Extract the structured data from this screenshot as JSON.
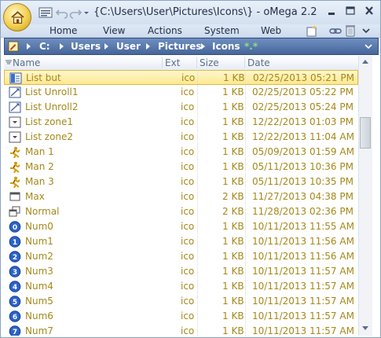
{
  "window": {
    "title": "{C:\\Users\\User\\Pictures\\Icons\\} - oMega 2.2"
  },
  "menu": [
    "Home",
    "View",
    "Actions",
    "System",
    "Web"
  ],
  "address": {
    "segments": [
      "C:",
      "Users",
      "User",
      "Pictures",
      "Icons",
      "*.*"
    ]
  },
  "columns": {
    "name": "Name",
    "ext": "Ext",
    "size": "Size",
    "date": "Date"
  },
  "files": [
    {
      "name": "List but",
      "ext": "ico",
      "size": "1 KB",
      "date": "02/25/2013 05:21 PM",
      "icon": "list-button-icon",
      "selected": true
    },
    {
      "name": "List Unroll1",
      "ext": "ico",
      "size": "1 KB",
      "date": "02/25/2013 05:22 PM",
      "icon": "list-unroll-icon"
    },
    {
      "name": "List Unroll2",
      "ext": "ico",
      "size": "1 KB",
      "date": "02/25/2013 05:24 PM",
      "icon": "list-unroll-icon"
    },
    {
      "name": "List zone1",
      "ext": "ico",
      "size": "1 KB",
      "date": "12/22/2013 01:03 PM",
      "icon": "list-zone-icon"
    },
    {
      "name": "List zone2",
      "ext": "ico",
      "size": "1 KB",
      "date": "12/22/2013 11:04 AM",
      "icon": "list-zone-icon"
    },
    {
      "name": "Man 1",
      "ext": "ico",
      "size": "1 KB",
      "date": "05/09/2013 01:59 AM",
      "icon": "running-man-icon"
    },
    {
      "name": "Man 2",
      "ext": "ico",
      "size": "1 KB",
      "date": "05/11/2013 10:36 PM",
      "icon": "running-man-icon"
    },
    {
      "name": "Man 3",
      "ext": "ico",
      "size": "1 KB",
      "date": "05/11/2013 10:35 PM",
      "icon": "running-man-icon"
    },
    {
      "name": "Max",
      "ext": "ico",
      "size": "2 KB",
      "date": "11/27/2013 04:38 PM",
      "icon": "maximize-window-icon"
    },
    {
      "name": "Normal",
      "ext": "ico",
      "size": "2 KB",
      "date": "11/28/2013 02:36 PM",
      "icon": "restore-window-icon"
    },
    {
      "name": "Num0",
      "ext": "ico",
      "size": "1 KB",
      "date": "10/11/2013 11:55 AM",
      "icon": "number-0-icon",
      "num": "0"
    },
    {
      "name": "Num1",
      "ext": "ico",
      "size": "1 KB",
      "date": "10/11/2013 11:56 AM",
      "icon": "number-1-icon",
      "num": "1"
    },
    {
      "name": "Num2",
      "ext": "ico",
      "size": "1 KB",
      "date": "10/11/2013 11:56 AM",
      "icon": "number-2-icon",
      "num": "2"
    },
    {
      "name": "Num3",
      "ext": "ico",
      "size": "1 KB",
      "date": "10/11/2013 11:57 AM",
      "icon": "number-3-icon",
      "num": "3"
    },
    {
      "name": "Num4",
      "ext": "ico",
      "size": "1 KB",
      "date": "10/11/2013 11:57 AM",
      "icon": "number-4-icon",
      "num": "4"
    },
    {
      "name": "Num5",
      "ext": "ico",
      "size": "1 KB",
      "date": "10/11/2013 11:57 AM",
      "icon": "number-5-icon",
      "num": "5"
    },
    {
      "name": "Num6",
      "ext": "ico",
      "size": "1 KB",
      "date": "10/11/2013 11:57 AM",
      "icon": "number-6-icon",
      "num": "6"
    },
    {
      "name": "Num7",
      "ext": "ico",
      "size": "1 KB",
      "date": "10/11/2013 11:57 AM",
      "icon": "number-7-icon",
      "num": "7"
    }
  ],
  "colors": {
    "file_text": "#a4881a",
    "selection": "#fde890",
    "address_bar": "#46659a"
  }
}
